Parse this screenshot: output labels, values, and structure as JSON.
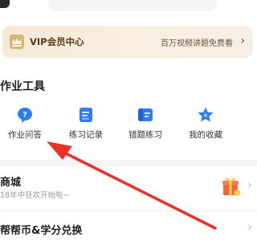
{
  "vip": {
    "title": "VIP会员中心",
    "subtitle": "百万视频讲题免费看",
    "chevron": "›",
    "icon": "crown-icon"
  },
  "tools": {
    "title": "作业工具",
    "items": [
      {
        "label": "作业问答",
        "icon": "question-chat-icon"
      },
      {
        "label": "练习记录",
        "icon": "practice-record-icon"
      },
      {
        "label": "错题练习",
        "icon": "wrong-question-icon"
      },
      {
        "label": "我的收藏",
        "icon": "favorites-icon"
      }
    ]
  },
  "mall": {
    "title": "商城",
    "subtitle": "18年中狂欢开始啦~",
    "icon": "gift-box-icon",
    "chevron": "›"
  },
  "exchange": {
    "title": "帮帮币&学分兑换",
    "chevron": "›"
  },
  "colors": {
    "accent_blue": "#2d7cf6",
    "vip_gold": "#c89b5b",
    "annotation_red": "#e8312a"
  }
}
